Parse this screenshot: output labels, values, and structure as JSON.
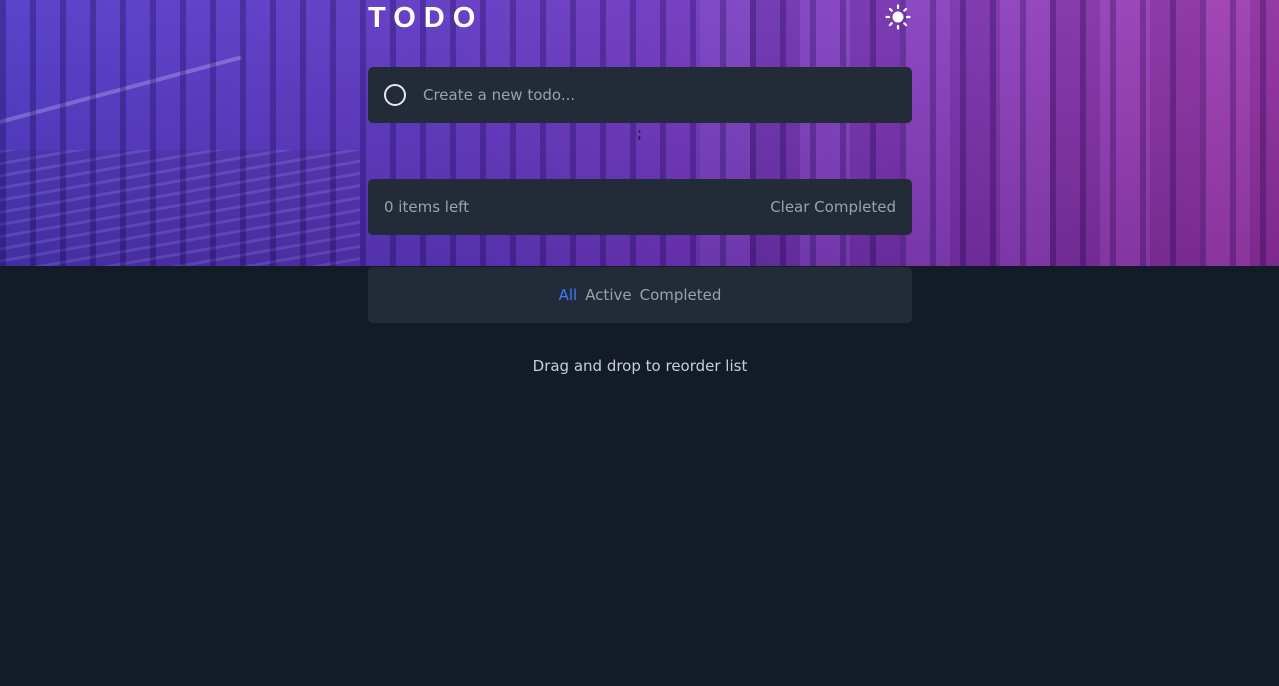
{
  "app": {
    "title": "TODO",
    "theme_toggle_icon": "sun-icon"
  },
  "new_todo": {
    "placeholder": "Create a new todo...",
    "value": ""
  },
  "stray_text": ";",
  "footer": {
    "items_left": "0 items left",
    "clear_label": "Clear Completed"
  },
  "filters": {
    "items": [
      {
        "label": "All",
        "active": true
      },
      {
        "label": "Active",
        "active": false
      },
      {
        "label": "Completed",
        "active": false
      }
    ]
  },
  "hint": "Drag and drop to reorder list",
  "colors": {
    "accent": "#3a7bfd",
    "background": "#131a28",
    "card": "#232b38"
  }
}
